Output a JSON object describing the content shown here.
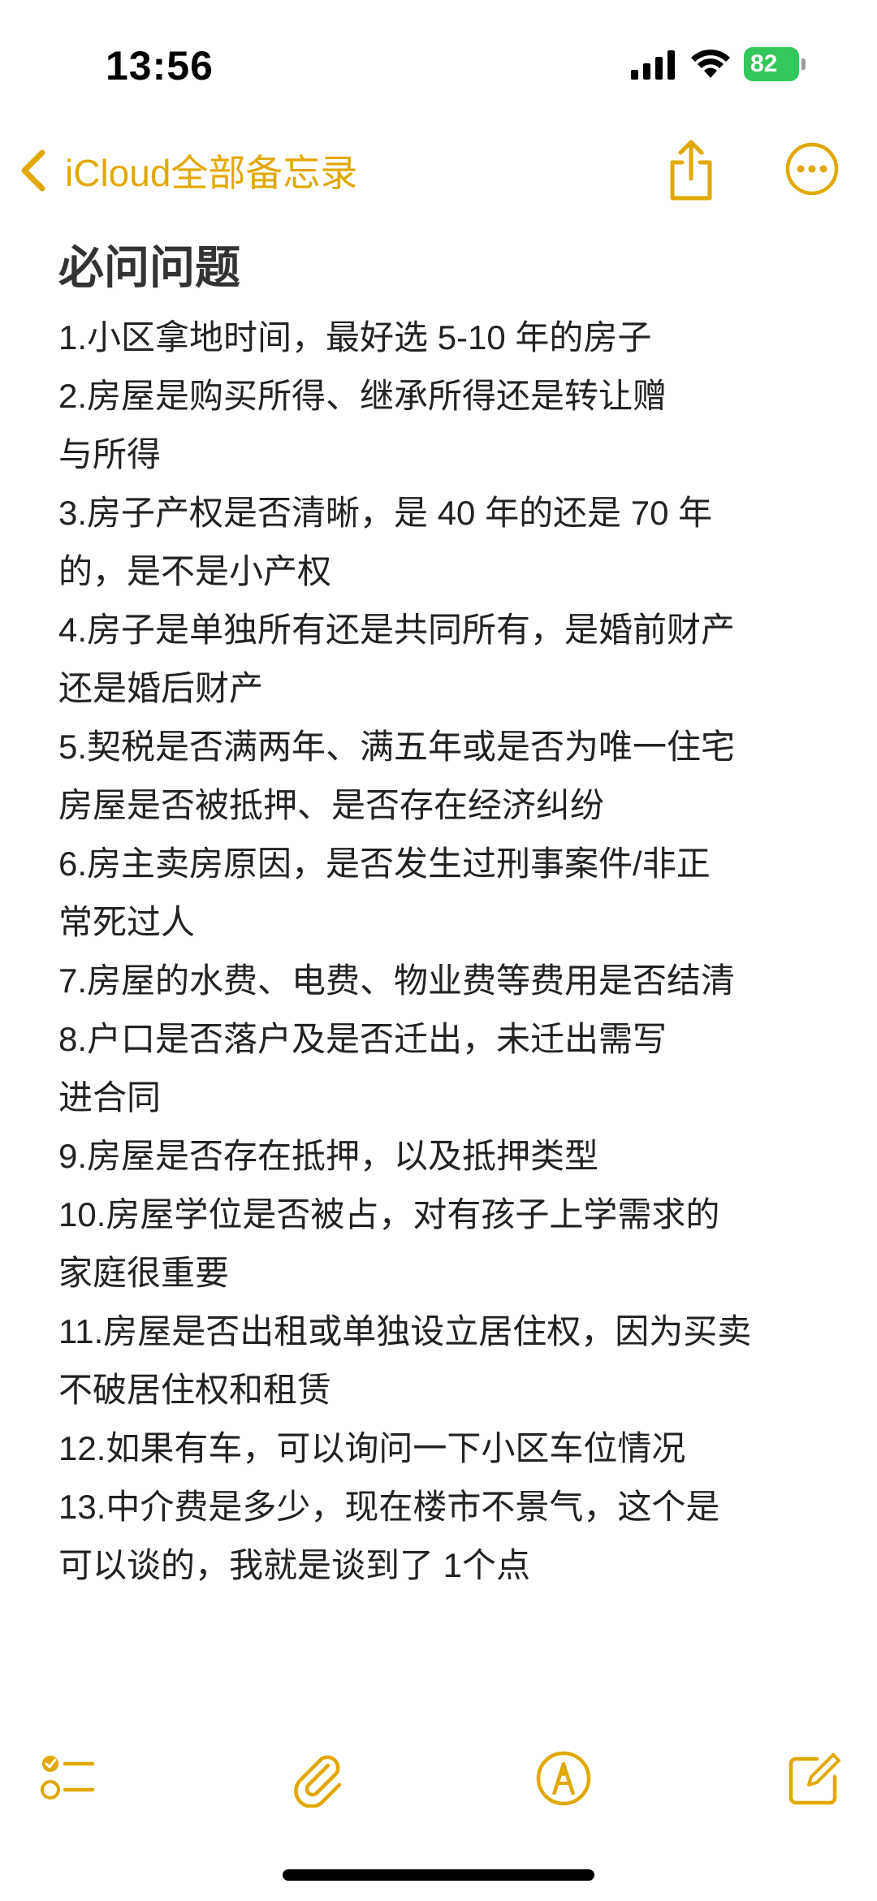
{
  "status_bar": {
    "time": "13:56",
    "battery_level": "82",
    "icons": [
      "signal-icon",
      "wifi-icon",
      "battery-icon"
    ]
  },
  "nav": {
    "back_label": "iCloud全部备忘录",
    "icons": [
      "chevron-left-icon",
      "share-icon",
      "more-icon"
    ],
    "accent_color": "#e0a800"
  },
  "note": {
    "title": "必问问题",
    "lines": [
      "1.小区拿地时间，最好选 5-10 年的房子",
      "2.房屋是购买所得、继承所得还是转让赠",
      "与所得",
      "3.房子产权是否清晰，是 40 年的还是 70 年",
      "的，是不是小产权",
      "4.房子是单独所有还是共同所有，是婚前财产",
      "还是婚后财产",
      "5.契税是否满两年、满五年或是否为唯一住宅",
      "房屋是否被抵押、是否存在经济纠纷",
      "6.房主卖房原因，是否发生过刑事案件/非正",
      "常死过人",
      "7.房屋的水费、电费、物业费等费用是否结清",
      "8.户口是否落户及是否迁出，未迁出需写",
      "进合同",
      "9.房屋是否存在抵押，以及抵押类型",
      "10.房屋学位是否被占，对有孩子上学需求的",
      "家庭很重要",
      "11.房屋是否出租或单独设立居住权，因为买卖",
      "不破居住权和租赁",
      "12.如果有车，可以询问一下小区车位情况",
      "13.中介费是多少，现在楼市不景气，这个是",
      "可以谈的，我就是谈到了 1个点"
    ]
  },
  "toolbar": {
    "icons": [
      "checklist-icon",
      "paperclip-icon",
      "markup-icon",
      "compose-icon"
    ]
  }
}
